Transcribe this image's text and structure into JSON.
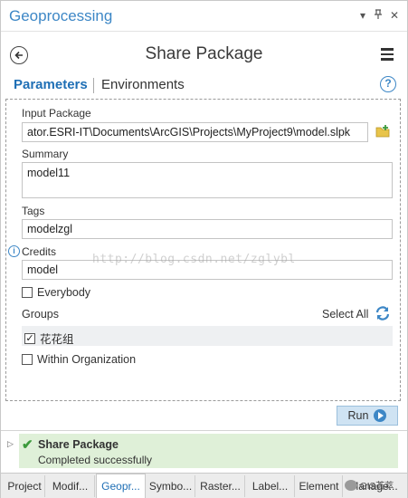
{
  "pane": {
    "title": "Geoprocessing",
    "controls": [
      "▾",
      "⊓",
      "✕"
    ]
  },
  "header": {
    "tool_title": "Share Package"
  },
  "tabs": [
    {
      "label": "Parameters",
      "active": true
    },
    {
      "label": "Environments",
      "active": false
    }
  ],
  "help": "?",
  "params": {
    "input_package": {
      "label": "Input Package",
      "value": "ator.ESRI-IT\\Documents\\ArcGIS\\Projects\\MyProject9\\model.slpk"
    },
    "summary": {
      "label": "Summary",
      "value": "model11"
    },
    "tags": {
      "label": "Tags",
      "value": "modelzgl"
    },
    "credits": {
      "label": "Credits",
      "value": "model"
    },
    "everybody": {
      "label": "Everybody",
      "checked": false
    },
    "groups": {
      "label": "Groups",
      "select_all": "Select All",
      "items": [
        {
          "label": "花花组",
          "checked": true
        }
      ]
    },
    "within_org": {
      "label": "Within Organization",
      "checked": false
    }
  },
  "watermark": "http://blog.csdn.net/zglybl",
  "run": {
    "label": "Run"
  },
  "status": {
    "title": "Share Package",
    "message": "Completed successfully"
  },
  "bottom_tabs": [
    {
      "label": "Project",
      "active": false
    },
    {
      "label": "Modif...",
      "active": false
    },
    {
      "label": "Geopr...",
      "active": true
    },
    {
      "label": "Symbo...",
      "active": false
    },
    {
      "label": "Raster...",
      "active": false
    },
    {
      "label": "Label...",
      "active": false
    },
    {
      "label": "Element",
      "active": false
    },
    {
      "label": "Manage...",
      "active": false
    }
  ],
  "wechat_label": "GIS荟萃",
  "colors": {
    "accent": "#3d87c6",
    "success_bg": "#dff0d8",
    "success": "#3c9a3c"
  }
}
